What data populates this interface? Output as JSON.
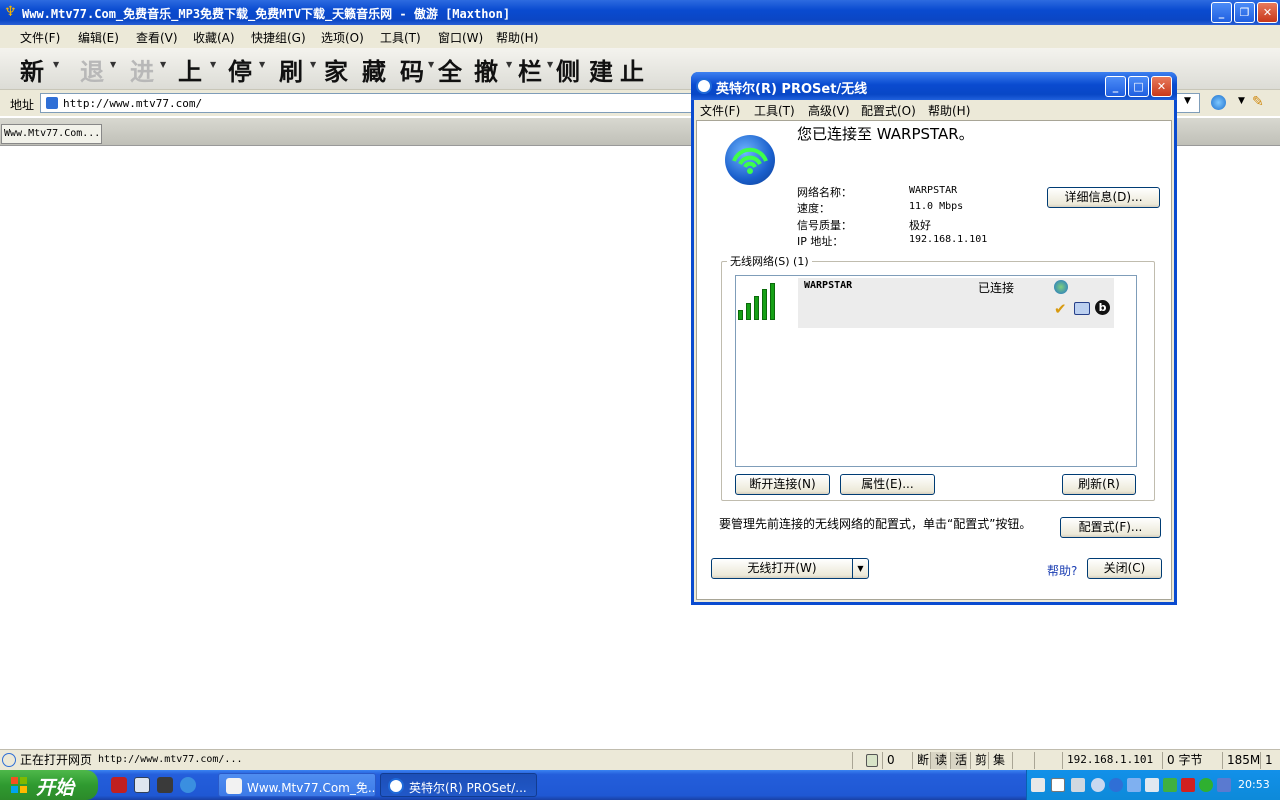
{
  "browser": {
    "title": "Www.Mtv77.Com_免费音乐_MP3免费下载_免费MTV下载_天籁音乐网 - 傲游 [Maxthon]",
    "menu": [
      "文件(F)",
      "编辑(E)",
      "查看(V)",
      "收藏(A)",
      "快捷组(G)",
      "选项(O)",
      "工具(T)",
      "窗口(W)",
      "帮助(H)"
    ],
    "toolbar": [
      "新",
      "退",
      "进",
      "上",
      "停",
      "刷",
      "家",
      "藏",
      "码",
      "全",
      "撤",
      "栏",
      "侧",
      "建",
      "止"
    ],
    "address_label": "地址",
    "address_url": "http://www.mtv77.com/",
    "tab_label": "Www.Mtv77.Com...",
    "status": {
      "text": "正在打开网页",
      "url": "http://www.mtv77.com/...",
      "count": "0",
      "modes": [
        "断",
        "读",
        "活",
        "剪",
        "集"
      ],
      "ip": "192.168.1.101",
      "bytes": "0 字节",
      "memory": "185M",
      "page": "1"
    }
  },
  "dialog": {
    "title": "英特尔(R) PROSet/无线",
    "menu": [
      "文件(F)",
      "工具(T)",
      "高级(V)",
      "配置式(O)",
      "帮助(H)"
    ],
    "connected_text": "您已连接至 WARPSTAR。",
    "info": [
      {
        "label": "网络名称：",
        "value": "WARPSTAR"
      },
      {
        "label": "速度：",
        "value": "11.0 Mbps"
      },
      {
        "label": "信号质量：",
        "value": "极好"
      },
      {
        "label": "IP 地址：",
        "value": "192.168.1.101"
      }
    ],
    "details_button": "详细信息(D)...",
    "group_title": "无线网络(S) (1)",
    "network": {
      "ssid": "WARPSTAR",
      "status": "已连接",
      "signal_bars": 5
    },
    "disconnect_button": "断开连接(N)",
    "properties_button": "属性(E)...",
    "refresh_button": "刷新(R)",
    "hint": "要管理先前连接的无线网络的配置式，单击“配置式”按钮。",
    "profiles_button": "配置式(F)...",
    "wireless_button": "无线打开(W)",
    "help_link": "帮助?",
    "close_button": "关闭(C)"
  },
  "taskbar": {
    "start": "开始",
    "tasks": [
      "Www.Mtv77.Com_免...",
      "英特尔(R) PROSet/..."
    ],
    "clock": "20:53"
  }
}
